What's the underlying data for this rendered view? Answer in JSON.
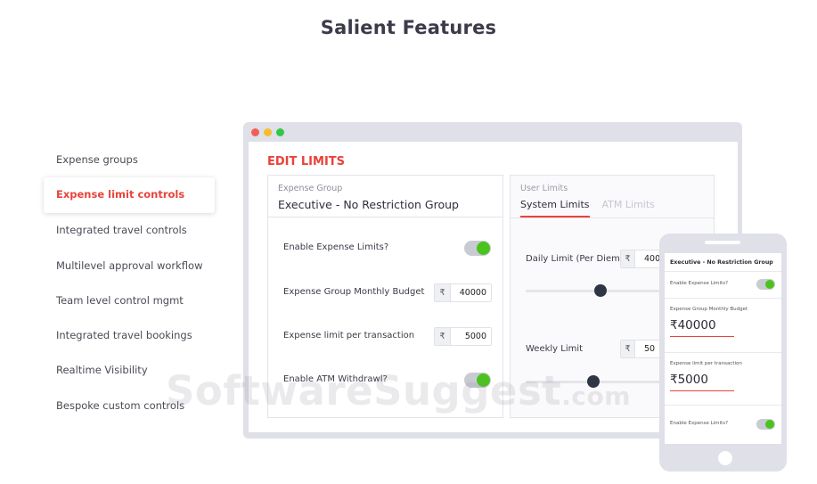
{
  "page": {
    "title": "Salient Features"
  },
  "features": [
    {
      "label": "Expense groups"
    },
    {
      "label": "Expense limit controls",
      "active": true
    },
    {
      "label": "Integrated travel controls"
    },
    {
      "label": "Multilevel approval workflow"
    },
    {
      "label": "Team level control mgmt"
    },
    {
      "label": "Integrated travel bookings"
    },
    {
      "label": "Realtime Visibility"
    },
    {
      "label": "Bespoke custom controls"
    }
  ],
  "window_dots": [
    "#f25f57",
    "#f7bd2e",
    "#33c748"
  ],
  "edit_limits": {
    "title": "EDIT LIMITS",
    "group_label": "Expense Group",
    "group_name": "Executive - No Restriction Group",
    "currency": "₹",
    "rows": {
      "enable_limits": {
        "label": "Enable Expense Limits?",
        "on": true
      },
      "monthly_budget": {
        "label": "Expense Group Monthly Budget",
        "value": "40000"
      },
      "per_transaction": {
        "label": "Expense limit per transaction",
        "value": "5000"
      },
      "atm_withdrawal": {
        "label": "Enable ATM Withdrawl?",
        "on": true
      }
    }
  },
  "user_limits": {
    "label": "User Limits",
    "tabs": [
      "System Limits",
      "ATM Limits"
    ],
    "active_tab": "System Limits",
    "daily": {
      "label": "Daily Limit (Per Diem)",
      "value": "400"
    },
    "weekly": {
      "label": "Weekly Limit",
      "value": "50"
    }
  },
  "phone": {
    "title": "Executive - No Restriction Group",
    "enable_label": "Enable Expense Limits?",
    "budget_label": "Expense Group Monthly Budget",
    "budget_value": "₹40000",
    "per_tx_label": "Expense limit per transaction",
    "per_tx_value": "₹5000",
    "enable_label_bottom": "Enable Expense Limits?"
  },
  "watermark": {
    "text": "SoftwareSuggest",
    "suffix": ".com"
  },
  "colors": {
    "accent": "#e8433a",
    "toggle_on": "#4bc31e",
    "frame": "#dfe0e8"
  }
}
